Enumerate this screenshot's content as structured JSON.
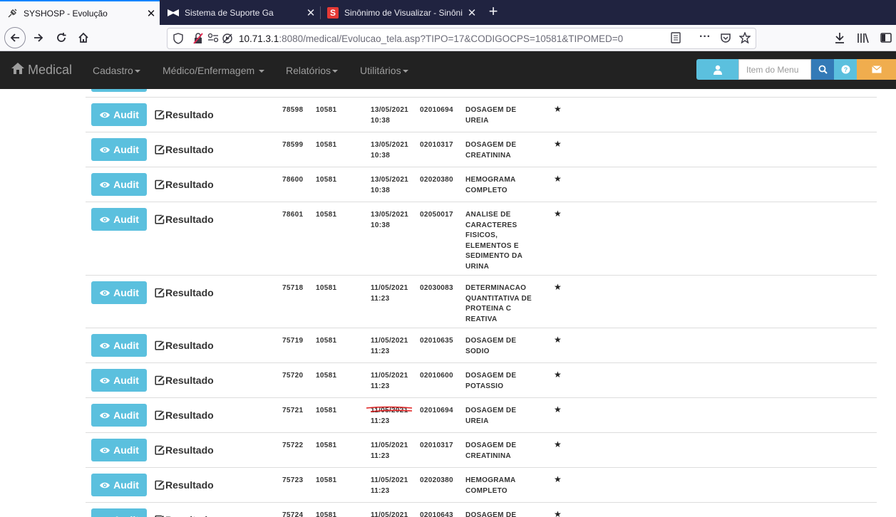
{
  "browser": {
    "tabs": [
      {
        "title": "SYSHOSP - Evolução",
        "active": true,
        "icon": "syringe-icon"
      },
      {
        "title": "Sistema de Suporte Ga",
        "active": false,
        "icon": "bowtie-icon"
      },
      {
        "title": "Sinônimo de Visualizar - Sinôni",
        "active": false,
        "icon": "s-logo-icon"
      }
    ],
    "url": {
      "host": "10.71.3.1",
      "rest": ":8080/medical/Evolucao_tela.asp?TIPO=17&CODIGOCPS=10581&TIPOMED=0"
    }
  },
  "navbar": {
    "brand": "Medical",
    "menu": [
      "Cadastro",
      "Médico/Enfermagem",
      "Relatórios",
      "Utilitários"
    ],
    "search_placeholder": "Item do Menu",
    "colors": {
      "bg": "#222222",
      "info": "#5bc0de",
      "primary": "#337ab7",
      "warning": "#f0ad4e"
    }
  },
  "row_actions": {
    "audit": "Audit",
    "resultado": "Resultado"
  },
  "rows": [
    {
      "id": "78598",
      "cps": "10581",
      "date": "13/05/2021",
      "time": "10:38",
      "code": "02010694",
      "desc": "DOSAGEM DE UREIA"
    },
    {
      "id": "78599",
      "cps": "10581",
      "date": "13/05/2021",
      "time": "10:38",
      "code": "02010317",
      "desc": "DOSAGEM DE CREATININA"
    },
    {
      "id": "78600",
      "cps": "10581",
      "date": "13/05/2021",
      "time": "10:38",
      "code": "02020380",
      "desc": "HEMOGRAMA COMPLETO"
    },
    {
      "id": "78601",
      "cps": "10581",
      "date": "13/05/2021",
      "time": "10:38",
      "code": "02050017",
      "desc": "ANALISE DE CARACTERES FISICOS, ELEMENTOS E SEDIMENTO DA URINA"
    },
    {
      "id": "75718",
      "cps": "10581",
      "date": "11/05/2021",
      "time": "11:23",
      "code": "02030083",
      "desc": "DETERMINACAO QUANTITATIVA DE PROTEINA C REATIVA"
    },
    {
      "id": "75719",
      "cps": "10581",
      "date": "11/05/2021",
      "time": "11:23",
      "code": "02010635",
      "desc": "DOSAGEM DE SODIO"
    },
    {
      "id": "75720",
      "cps": "10581",
      "date": "11/05/2021",
      "time": "11:23",
      "code": "02010600",
      "desc": "DOSAGEM DE POTASSIO"
    },
    {
      "id": "75721",
      "cps": "10581",
      "date": "11/05/2021",
      "time": "11:23",
      "code": "02010694",
      "desc": "DOSAGEM DE UREIA"
    },
    {
      "id": "75722",
      "cps": "10581",
      "date": "11/05/2021",
      "time": "11:23",
      "code": "02010317",
      "desc": "DOSAGEM DE CREATININA"
    },
    {
      "id": "75723",
      "cps": "10581",
      "date": "11/05/2021",
      "time": "11:23",
      "code": "02020380",
      "desc": "HEMOGRAMA COMPLETO"
    },
    {
      "id": "75724",
      "cps": "10581",
      "date": "11/05/2021",
      "time": "",
      "code": "02010643",
      "desc": "DOSAGEM DE"
    }
  ]
}
